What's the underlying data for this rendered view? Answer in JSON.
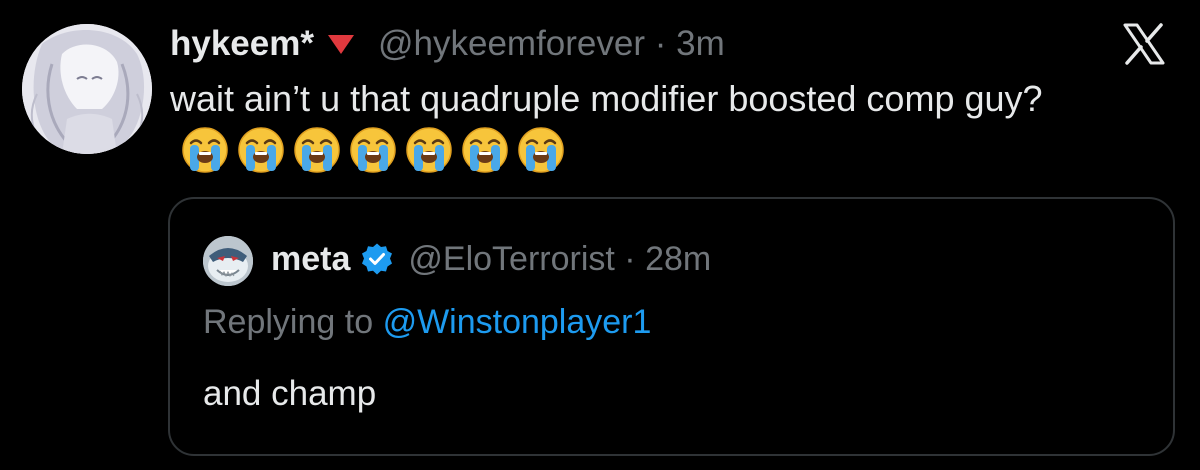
{
  "tweet": {
    "author_name": "hykeem*",
    "handle": "@hykeemforever",
    "separator": "·",
    "time": "3m",
    "text": "wait ain’t u that quadruple modifier boosted comp guy?",
    "emoji_count": 7,
    "emoji_name": "loudly-crying-face",
    "flag_icon": "red-triangle-down-icon"
  },
  "quote": {
    "author_name": "meta",
    "verified": true,
    "handle": "@EloTerrorist",
    "separator": "·",
    "time": "28m",
    "replying_prefix": "Replying to",
    "replying_to": "@Winstonplayer1",
    "text": "and champ"
  },
  "colors": {
    "background": "#000000",
    "text": "#e7e9ea",
    "muted": "#71767b",
    "link": "#1d9bf0",
    "border": "#2f3336",
    "verified": "#1d9bf0",
    "flag": "#e0393e"
  },
  "icons": {
    "close": "x-logo-icon"
  }
}
